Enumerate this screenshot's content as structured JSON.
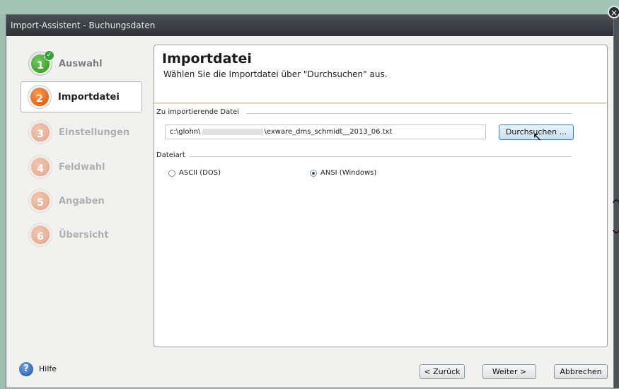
{
  "window": {
    "title": "Import-Assistent - Buchungsdaten",
    "close_glyph": "×"
  },
  "sidebar": {
    "steps": [
      {
        "num": "1",
        "label": "Auswahl",
        "state": "done"
      },
      {
        "num": "2",
        "label": "Importdatei",
        "state": "current"
      },
      {
        "num": "3",
        "label": "Einstellungen",
        "state": "todo"
      },
      {
        "num": "4",
        "label": "Feldwahl",
        "state": "todo"
      },
      {
        "num": "5",
        "label": "Angaben",
        "state": "todo"
      },
      {
        "num": "6",
        "label": "Übersicht",
        "state": "todo"
      }
    ],
    "check_glyph": "✓"
  },
  "panel": {
    "title": "Importdatei",
    "subtitle": "Wählen Sie die Importdatei über \"Durchsuchen\" aus.",
    "file_group_label": "Zu importierende Datei",
    "file_path_start": "c:\\glohn\\",
    "file_path_end": "\\exware_dms_schmidt__2013_06.txt",
    "browse_label": "Durchsuchen ...",
    "type_group_label": "Dateiart",
    "options": [
      {
        "label": "ASCII (DOS)",
        "selected": false
      },
      {
        "label": "ANSI (Windows)",
        "selected": true
      }
    ]
  },
  "footer": {
    "help_glyph": "?",
    "help_label": "Hilfe",
    "back_label": "< Zurück",
    "next_label": "Weiter >",
    "cancel_label": "Abbrechen"
  },
  "colors": {
    "accent": "#3c7fb1",
    "step_done": "#2f8e23",
    "step_current": "#d4520c"
  }
}
